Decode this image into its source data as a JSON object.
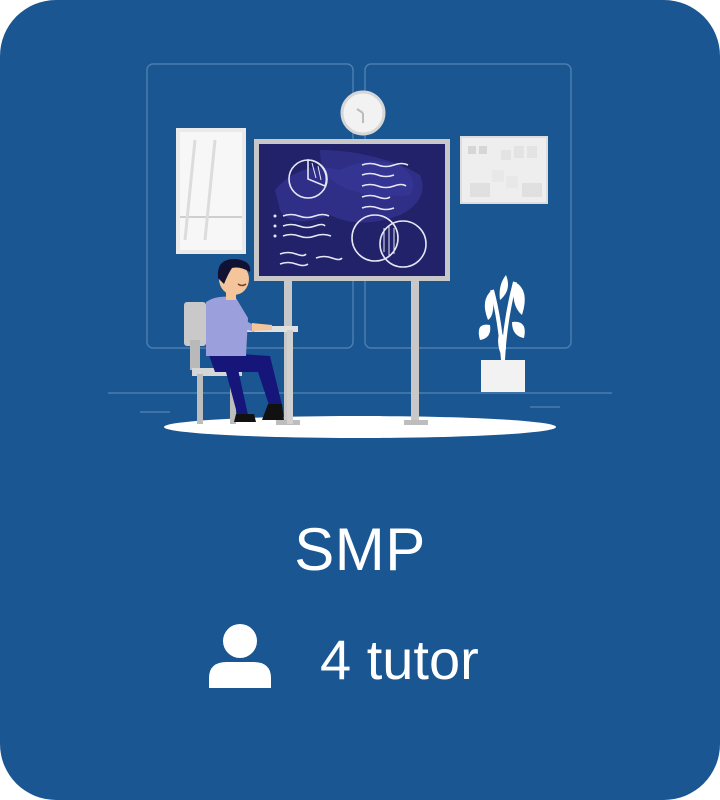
{
  "card": {
    "title": "SMP",
    "tutor_count": "4 tutor",
    "user_icon": "user-icon",
    "illustration": "classroom-student-illustration"
  },
  "colors": {
    "card_background": "#1a5691",
    "text": "#ffffff",
    "board": "#22226a",
    "student_shirt": "#9b9fdc",
    "student_pants": "#15157a"
  }
}
